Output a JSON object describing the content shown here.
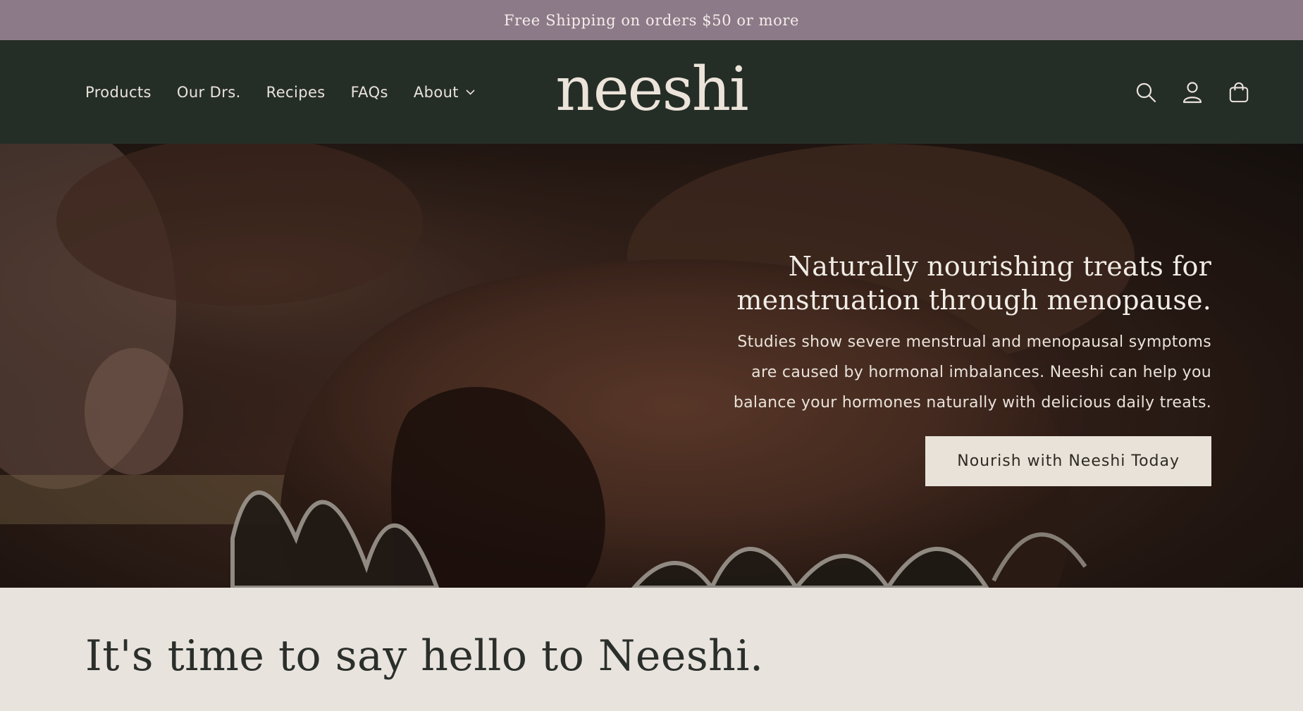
{
  "announcement": {
    "text": "Free Shipping on orders $50 or more"
  },
  "header": {
    "nav": [
      {
        "label": "Products"
      },
      {
        "label": "Our Drs."
      },
      {
        "label": "Recipes"
      },
      {
        "label": "FAQs"
      },
      {
        "label": "About",
        "has_dropdown": true
      }
    ],
    "logo": "neeshi",
    "icons": [
      "search-icon",
      "account-icon",
      "cart-icon"
    ]
  },
  "hero": {
    "title_line1": "Naturally nourishing treats for",
    "title_line2": "menstruation through menopause.",
    "body_line1": "Studies show severe menstrual and menopausal symptoms",
    "body_line2": "are caused by hormonal imbalances. Neeshi can help you",
    "body_line3": "balance your hormones naturally with delicious daily treats.",
    "cta_label": "Nourish with Neeshi Today"
  },
  "intro": {
    "title": "It's time to say hello to Neeshi."
  },
  "colors": {
    "announcement_bg": "#8d7a88",
    "header_bg": "#252e26",
    "cream": "#e8e3dd",
    "text_dark": "#2b2f2b"
  }
}
